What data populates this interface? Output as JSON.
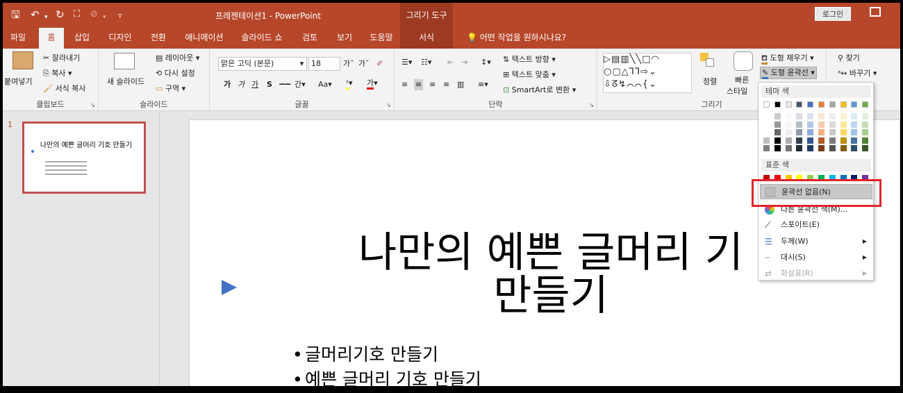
{
  "app": {
    "doc_title": "프레젠테이션1 - PowerPoint",
    "tool_context": "그리기 도구",
    "login": "로그인",
    "tell_me": "어떤 작업을 원하시나요?"
  },
  "tabs": [
    "파일",
    "홈",
    "삽입",
    "디자인",
    "전환",
    "애니메이션",
    "슬라이드 쇼",
    "검토",
    "보기",
    "도움말",
    "서식"
  ],
  "ribbon": {
    "clipboard": {
      "paste": "붙여넣기",
      "cut": "잘라내기",
      "copy": "복사",
      "format_painter": "서식 복사",
      "label": "클립보드"
    },
    "slides": {
      "new_slide": "새 슬라이드",
      "layout": "레이아웃",
      "reset": "다시 설정",
      "section": "구역",
      "label": "슬라이드"
    },
    "font": {
      "font_name": "맑은 고딕 (본문)",
      "font_size": "18",
      "label": "글꼴",
      "bold": "가",
      "italic": "가",
      "underline": "가",
      "shadow": "S",
      "strike": "ᆂᆂᆂ",
      "spacing": "간",
      "case": "Aa"
    },
    "paragraph": {
      "text_direction": "텍스트 방향",
      "align_text": "텍스트 맞춤",
      "smartart": "SmartArt로 변환",
      "label": "단락"
    },
    "drawing": {
      "arrange": "정렬",
      "quick_styles_line1": "빠른",
      "quick_styles_line2": "스타일",
      "fill": "도형 채우기",
      "outline": "도형 윤곽선",
      "label": "그리기"
    },
    "editing": {
      "find": "찾기",
      "replace": "바꾸기"
    }
  },
  "thumbnail": {
    "number": "1",
    "title": "나만의 예쁜 글머리 기호 만들기"
  },
  "slide": {
    "title_line1": "나만의 예쁜 글머리 기",
    "title_line2": "만들기",
    "bullets": [
      "글머리기호 만들기",
      "예쁜 글머리 기호 만들기"
    ]
  },
  "dropdown": {
    "theme_header": "테마 색",
    "standard_header": "표준 색",
    "no_outline": "윤곽선 없음(N)",
    "more_colors": "다른 윤곽선 색(M)...",
    "eyedropper": "스포이트(E)",
    "weight": "두께(W)",
    "dashes": "대시(S)",
    "arrows": "화살표(R)",
    "theme_top_row": [
      "#ffffff",
      "#000000",
      "#e7e6e6",
      "#44546a",
      "#4472c4",
      "#ed7d31",
      "#a5a5a5",
      "#ffc000",
      "#5b9bd5",
      "#70ad47"
    ],
    "standard_row": [
      "#c00000",
      "#ff0000",
      "#ffc000",
      "#ffff00",
      "#92d050",
      "#00b050",
      "#00b0f0",
      "#0070c0",
      "#002060",
      "#7030a0"
    ]
  }
}
